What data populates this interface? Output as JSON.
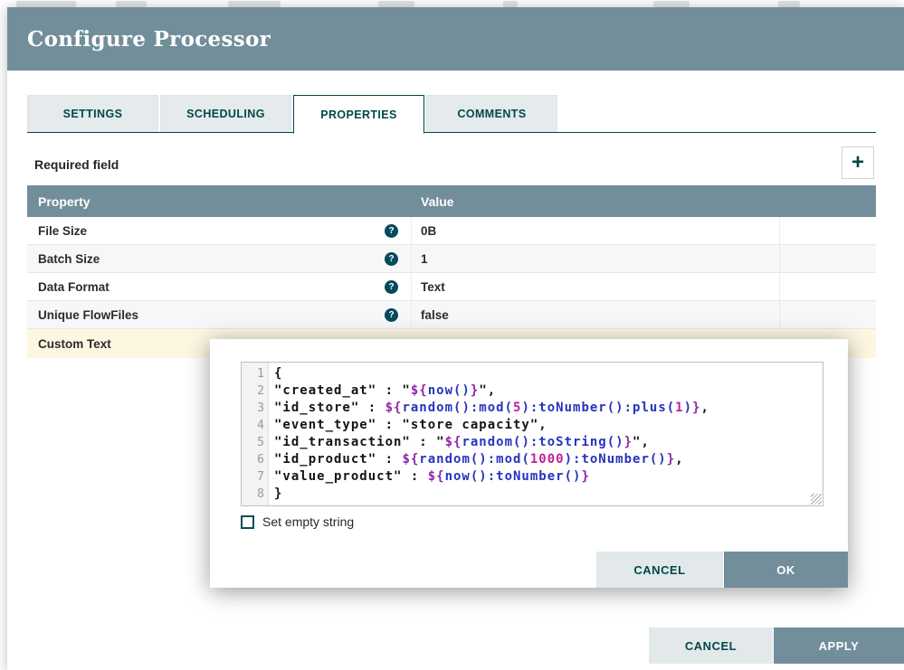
{
  "window": {
    "title": "Configure Processor"
  },
  "tabs": [
    {
      "label": "SETTINGS",
      "active": false
    },
    {
      "label": "SCHEDULING",
      "active": false
    },
    {
      "label": "PROPERTIES",
      "active": true
    },
    {
      "label": "COMMENTS",
      "active": false
    }
  ],
  "properties_tab": {
    "required_field_label": "Required field",
    "add_button_glyph": "+",
    "table": {
      "columns": [
        "Property",
        "Value"
      ],
      "help_glyph": "?",
      "rows": [
        {
          "property": "File Size",
          "value": "0B",
          "has_help": true,
          "highlighted": false
        },
        {
          "property": "Batch Size",
          "value": "1",
          "has_help": true,
          "highlighted": false
        },
        {
          "property": "Data Format",
          "value": "Text",
          "has_help": true,
          "highlighted": false
        },
        {
          "property": "Unique FlowFiles",
          "value": "false",
          "has_help": true,
          "highlighted": false
        },
        {
          "property": "Custom Text",
          "value": "",
          "has_help": false,
          "highlighted": true
        }
      ]
    }
  },
  "value_editor": {
    "lines": [
      {
        "num": "1",
        "segments": [
          {
            "type": "p",
            "text": "{"
          }
        ]
      },
      {
        "num": "2",
        "segments": [
          {
            "type": "p",
            "text": "\"created_at\" : \""
          },
          {
            "type": "d",
            "text": "${"
          },
          {
            "type": "f",
            "text": "now()"
          },
          {
            "type": "d",
            "text": "}"
          },
          {
            "type": "p",
            "text": "\","
          }
        ]
      },
      {
        "num": "3",
        "segments": [
          {
            "type": "p",
            "text": "\"id_store\" : "
          },
          {
            "type": "d",
            "text": "${"
          },
          {
            "type": "f",
            "text": "random():mod("
          },
          {
            "type": "n",
            "text": "5"
          },
          {
            "type": "f",
            "text": "):toNumber():plus("
          },
          {
            "type": "n",
            "text": "1"
          },
          {
            "type": "f",
            "text": ")"
          },
          {
            "type": "d",
            "text": "}"
          },
          {
            "type": "p",
            "text": ","
          }
        ]
      },
      {
        "num": "4",
        "segments": [
          {
            "type": "p",
            "text": "\"event_type\" : \"store capacity\","
          }
        ]
      },
      {
        "num": "5",
        "segments": [
          {
            "type": "p",
            "text": "\"id_transaction\" : \""
          },
          {
            "type": "d",
            "text": "${"
          },
          {
            "type": "f",
            "text": "random():toString()"
          },
          {
            "type": "d",
            "text": "}"
          },
          {
            "type": "p",
            "text": "\","
          }
        ]
      },
      {
        "num": "6",
        "segments": [
          {
            "type": "p",
            "text": "\"id_product\" : "
          },
          {
            "type": "d",
            "text": "${"
          },
          {
            "type": "f",
            "text": "random():mod("
          },
          {
            "type": "n",
            "text": "1000"
          },
          {
            "type": "f",
            "text": "):toNumber()"
          },
          {
            "type": "d",
            "text": "}"
          },
          {
            "type": "p",
            "text": ","
          }
        ]
      },
      {
        "num": "7",
        "segments": [
          {
            "type": "p",
            "text": "\"value_product\" : "
          },
          {
            "type": "d",
            "text": "${"
          },
          {
            "type": "f",
            "text": "now():toNumber()"
          },
          {
            "type": "d",
            "text": "}"
          }
        ]
      },
      {
        "num": "8",
        "segments": [
          {
            "type": "p",
            "text": "}"
          }
        ]
      }
    ],
    "empty_string_label": "Set empty string",
    "buttons": {
      "cancel": "CANCEL",
      "ok": "OK"
    }
  },
  "footer_buttons": {
    "cancel": "CANCEL",
    "apply": "APPLY"
  },
  "colors": {
    "header_bg": "#728e9b",
    "accent_teal": "#004849",
    "row_highlight": "#fdf7e2",
    "el_delimiter": "#8e24aa",
    "el_function": "#2734bd",
    "el_number": "#c2219c",
    "button_light_bg": "#e3e8eb",
    "button_dark_bg": "#728e9b"
  }
}
